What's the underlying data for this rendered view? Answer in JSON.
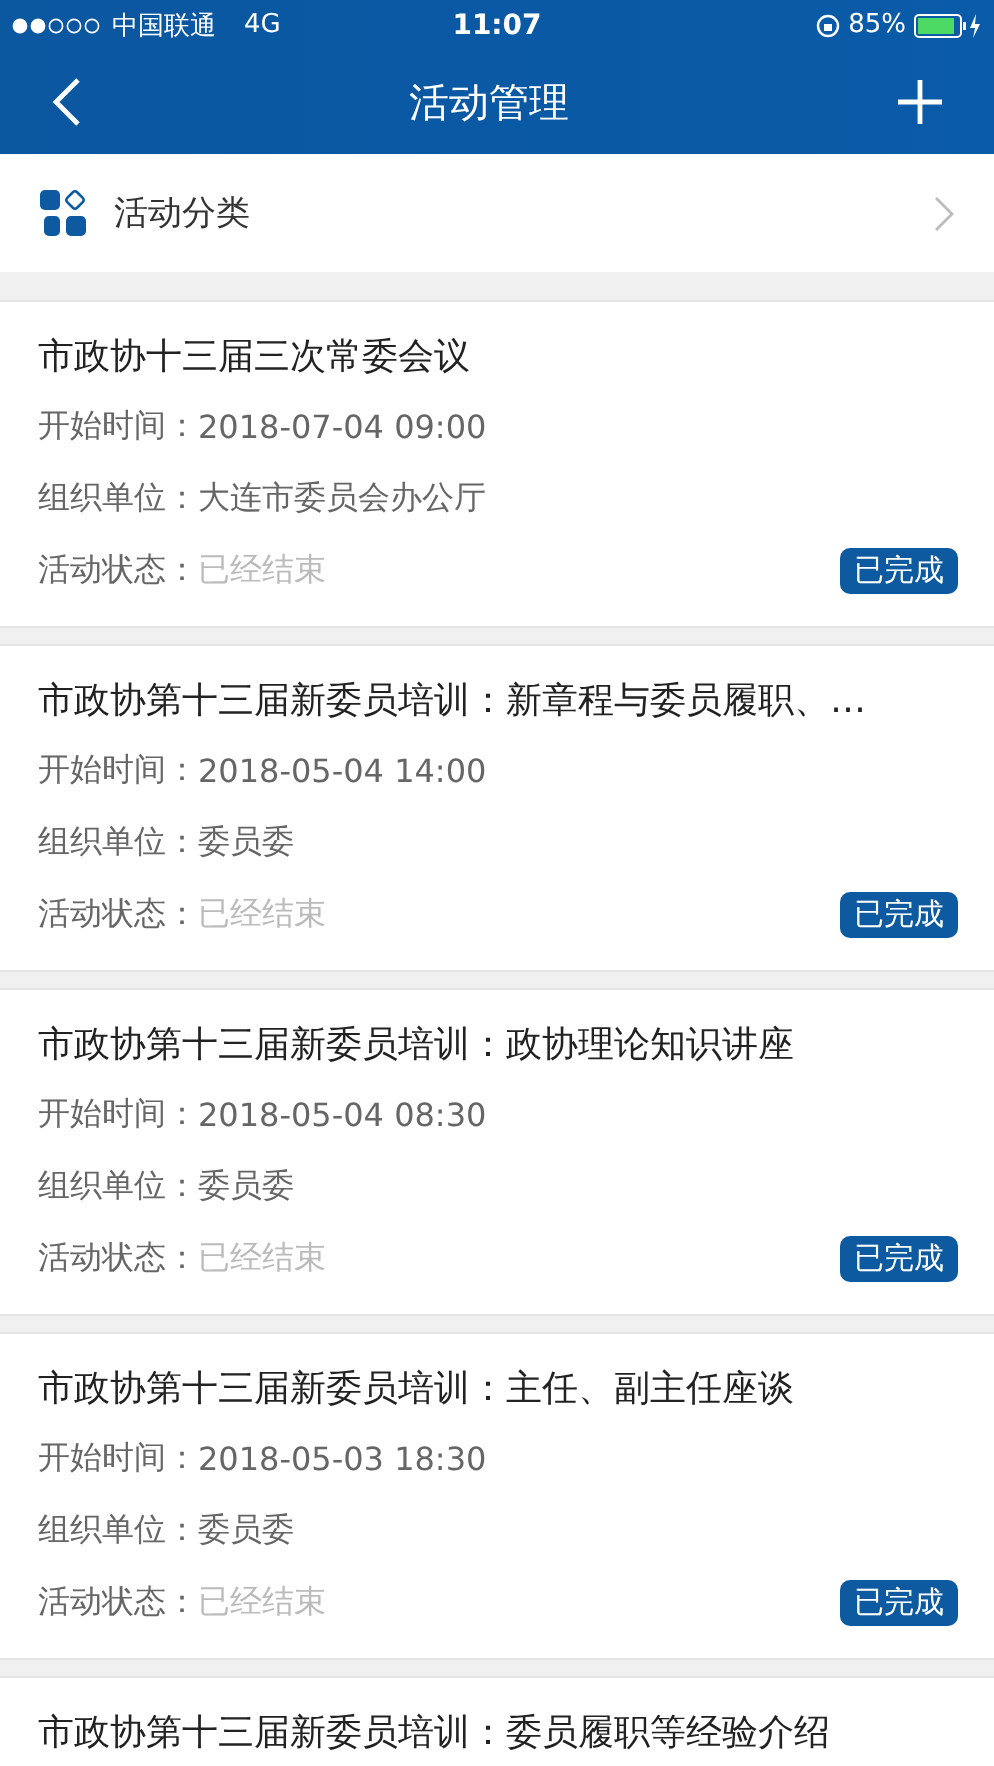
{
  "status_bar": {
    "carrier": "中国联通",
    "network": "4G",
    "time": "11:07",
    "battery": "85%"
  },
  "nav": {
    "title": "活动管理"
  },
  "category": {
    "label": "活动分类"
  },
  "activities": [
    {
      "title": "市政协十三届三次常委会议",
      "fields": [
        {
          "label": "开始时间：",
          "value": "2018-07-04 09:00",
          "kind": "normal"
        },
        {
          "label": "组织单位：",
          "value": "大连市委员会办公厅",
          "kind": "normal"
        },
        {
          "label": "活动状态：",
          "value": "已经结束",
          "kind": "muted"
        }
      ],
      "badge": "已完成"
    },
    {
      "title": "市政协第十三届新委员培训：新章程与委员履职、…",
      "fields": [
        {
          "label": "开始时间：",
          "value": "2018-05-04 14:00",
          "kind": "normal"
        },
        {
          "label": "组织单位：",
          "value": "委员委",
          "kind": "normal"
        },
        {
          "label": "活动状态：",
          "value": "已经结束",
          "kind": "muted"
        }
      ],
      "badge": "已完成"
    },
    {
      "title": "市政协第十三届新委员培训：政协理论知识讲座",
      "fields": [
        {
          "label": "开始时间：",
          "value": "2018-05-04 08:30",
          "kind": "normal"
        },
        {
          "label": "组织单位：",
          "value": "委员委",
          "kind": "normal"
        },
        {
          "label": "活动状态：",
          "value": "已经结束",
          "kind": "muted"
        }
      ],
      "badge": "已完成"
    },
    {
      "title": "市政协第十三届新委员培训：主任、副主任座谈",
      "fields": [
        {
          "label": "开始时间：",
          "value": "2018-05-03 18:30",
          "kind": "normal"
        },
        {
          "label": "组织单位：",
          "value": "委员委",
          "kind": "normal"
        },
        {
          "label": "活动状态：",
          "value": "已经结束",
          "kind": "muted"
        }
      ],
      "badge": "已完成"
    },
    {
      "title": "市政协第十三届新委员培训：委员履职等经验介绍"
    }
  ]
}
